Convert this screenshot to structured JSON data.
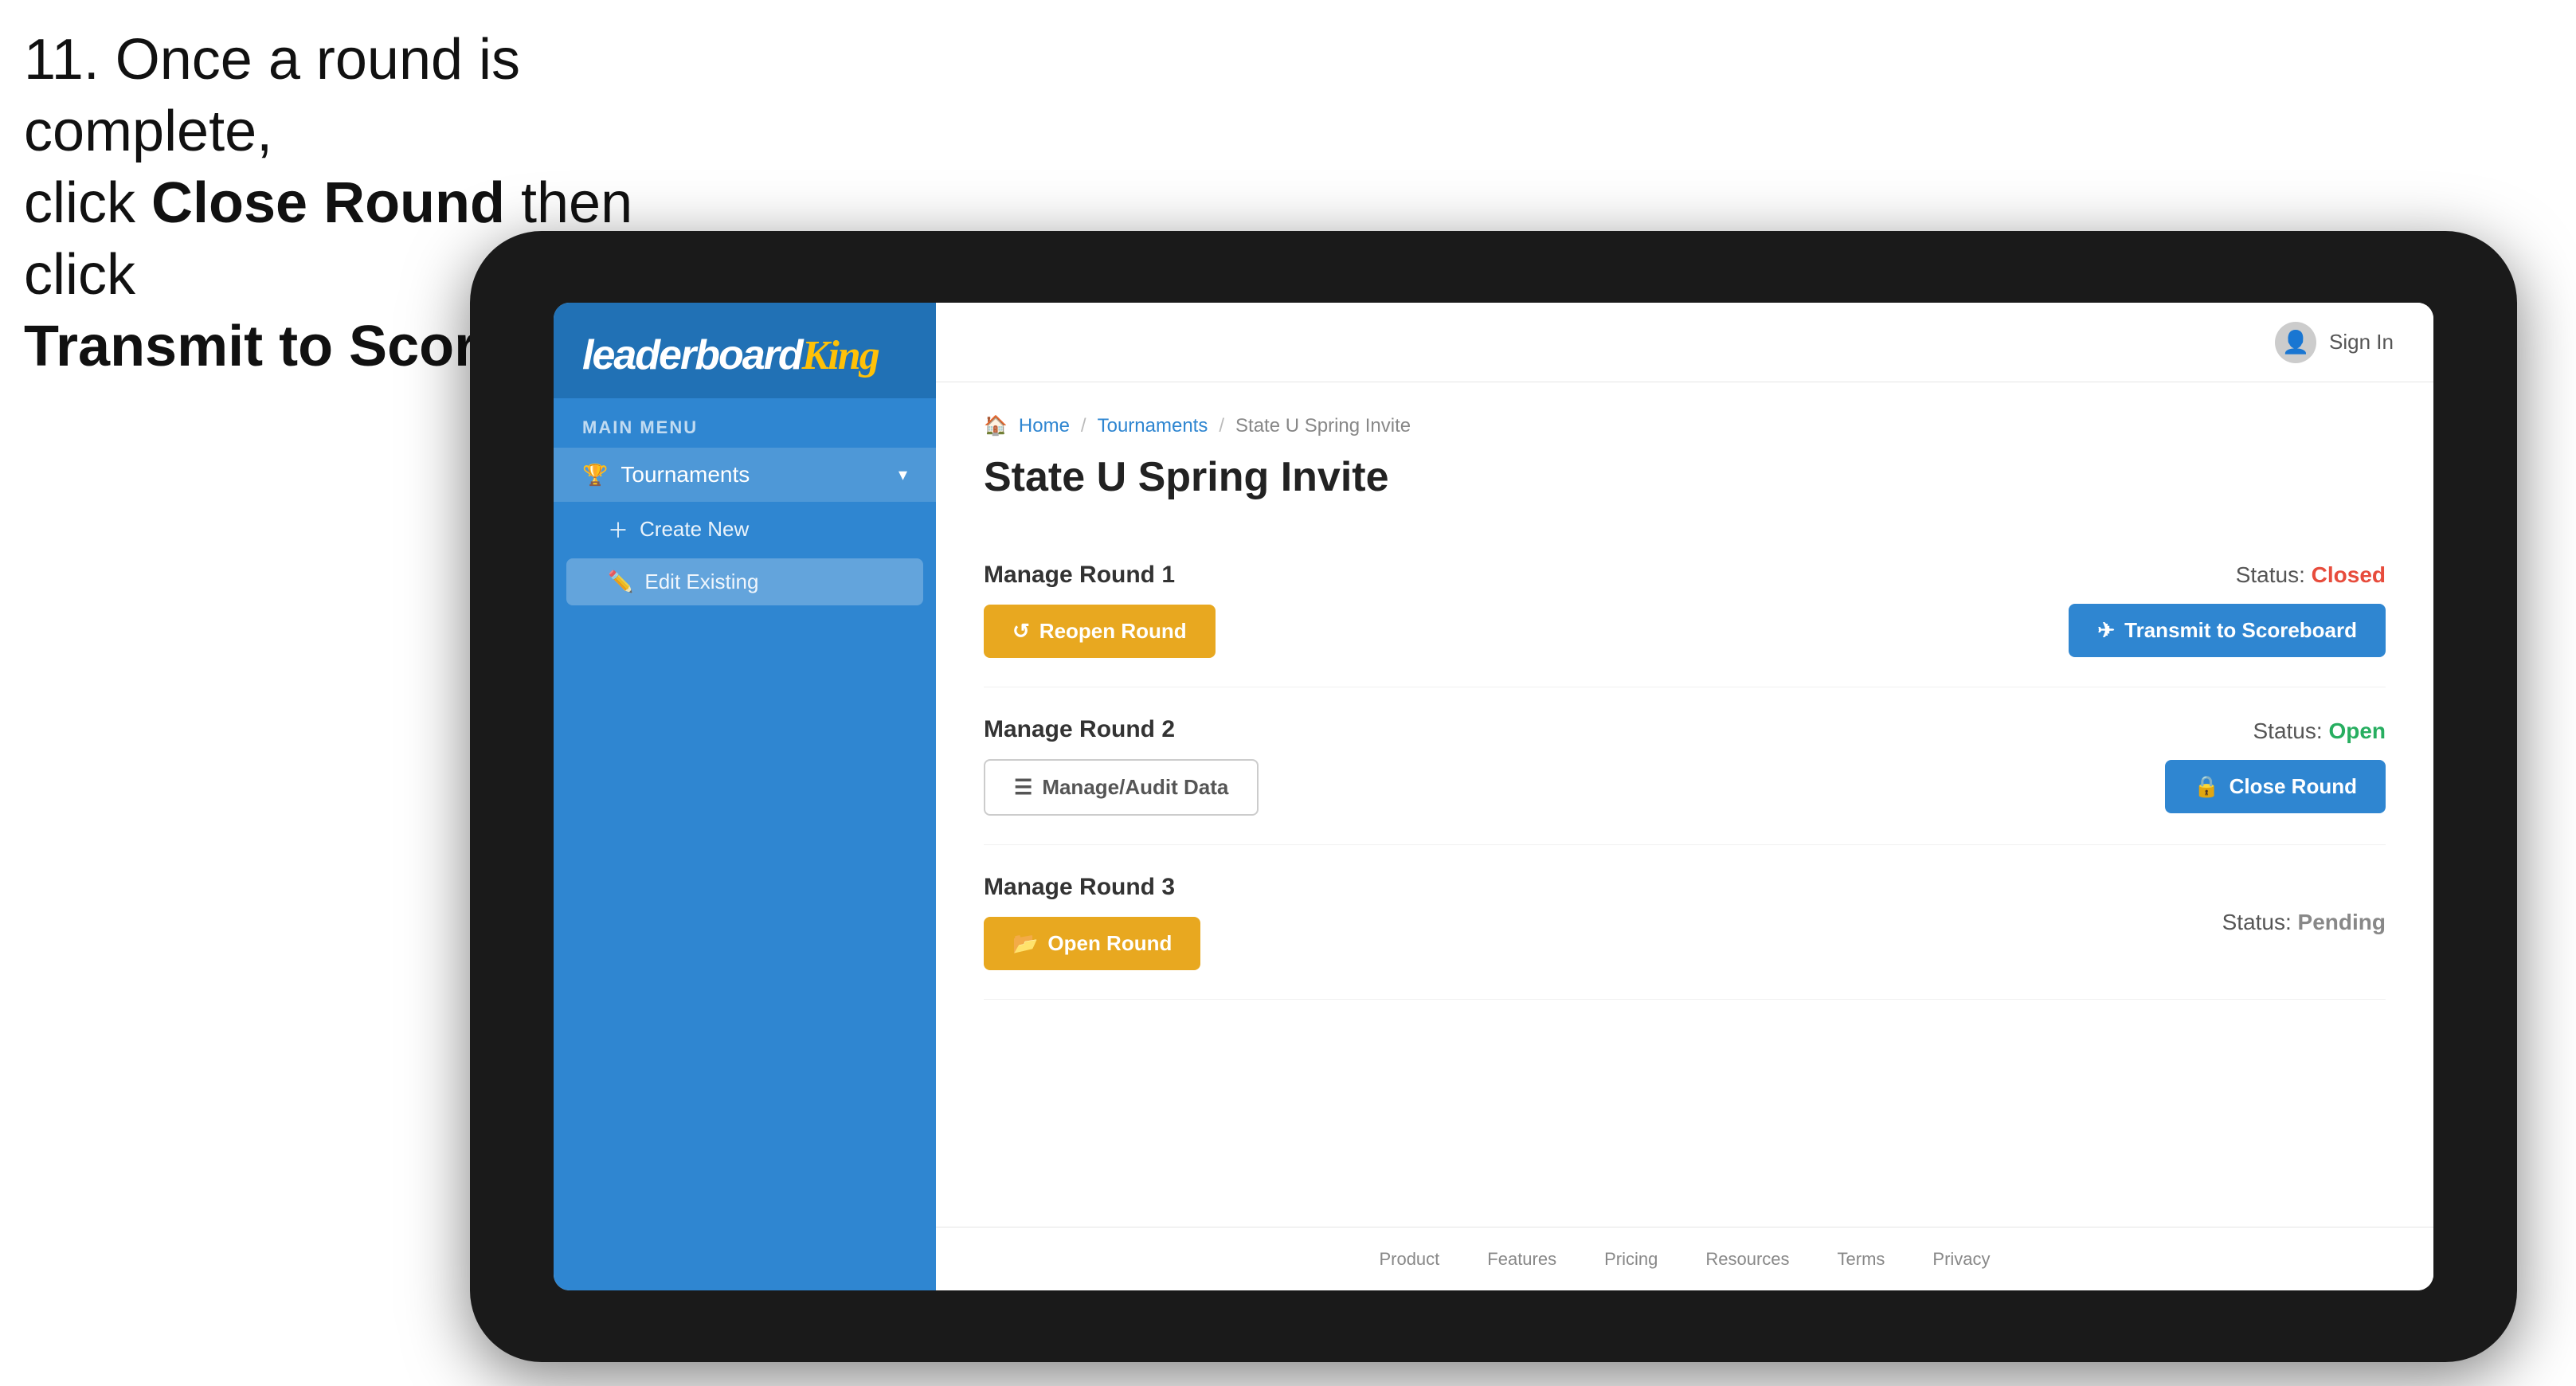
{
  "instruction": {
    "line1": "11. Once a round is complete,",
    "line2_prefix": "click ",
    "line2_bold": "Close Round",
    "line2_suffix": " then click",
    "line3_bold": "Transmit to Scoreboard."
  },
  "sidebar": {
    "logo": "leaderboard",
    "logo_highlight": "King",
    "main_menu_label": "MAIN MENU",
    "tournaments_label": "Tournaments",
    "create_new_label": "Create New",
    "edit_existing_label": "Edit Existing"
  },
  "header": {
    "sign_in_label": "Sign In"
  },
  "breadcrumb": {
    "home": "Home",
    "tournaments": "Tournaments",
    "current": "State U Spring Invite"
  },
  "page_title": "State U Spring Invite",
  "rounds": [
    {
      "id": "round1",
      "title": "Manage Round 1",
      "status_label": "Status:",
      "status_value": "Closed",
      "status_type": "closed",
      "primary_btn_label": "Reopen Round",
      "primary_btn_icon": "↺",
      "secondary_btn_label": "Transmit to Scoreboard",
      "secondary_btn_icon": "✈"
    },
    {
      "id": "round2",
      "title": "Manage Round 2",
      "status_label": "Status:",
      "status_value": "Open",
      "status_type": "open",
      "primary_btn_label": "Manage/Audit Data",
      "primary_btn_icon": "☰",
      "secondary_btn_label": "Close Round",
      "secondary_btn_icon": "🔒"
    },
    {
      "id": "round3",
      "title": "Manage Round 3",
      "status_label": "Status:",
      "status_value": "Pending",
      "status_type": "pending",
      "primary_btn_label": "Open Round",
      "primary_btn_icon": "📂",
      "secondary_btn_label": null
    }
  ],
  "footer": {
    "links": [
      "Product",
      "Features",
      "Pricing",
      "Resources",
      "Terms",
      "Privacy"
    ]
  }
}
